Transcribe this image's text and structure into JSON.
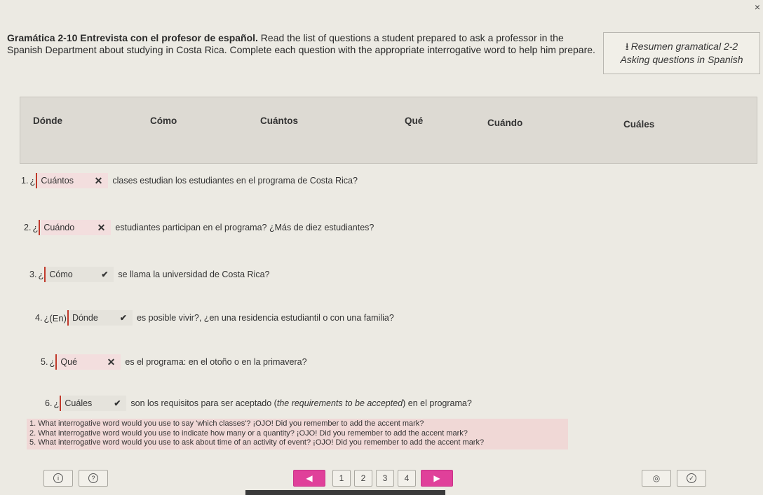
{
  "window": {
    "close_glyph": "×"
  },
  "instructions": {
    "title": "Gramática 2-10 Entrevista con el profesor de español.",
    "body": " Read the list of questions a student prepared to ask a professor in the Spanish Department about studying in Costa Rica. Complete each question with the appropriate interrogative word to help him prepare."
  },
  "resource": {
    "icon": "download-icon",
    "line1": "Resumen gramatical 2-2",
    "line2": "Asking questions in Spanish"
  },
  "word_bank": [
    "Dónde",
    "Cómo",
    "Cuántos",
    "Qué",
    "Cuándo",
    "Cuáles"
  ],
  "questions": [
    {
      "num": "1.",
      "pre": "¿",
      "answer": "Cuántos",
      "status": "incorrect",
      "mark": "✕",
      "text": "clases estudian los estudiantes en el programa de Costa Rica?"
    },
    {
      "num": "2.",
      "pre": "¿",
      "answer": "Cuándo",
      "status": "incorrect",
      "mark": "✕",
      "text": "estudiantes participan en el programa? ¿Más de diez estudiantes?"
    },
    {
      "num": "3.",
      "pre": "¿",
      "answer": "Cómo",
      "status": "correct",
      "mark": "✔",
      "text": "se llama la universidad de Costa Rica?"
    },
    {
      "num": "4.",
      "pre": "¿(En)",
      "answer": "Dónde",
      "status": "correct",
      "mark": "✔",
      "text": "es posible vivir?, ¿en una residencia estudiantil o con una familia?"
    },
    {
      "num": "5.",
      "pre": "¿",
      "answer": "Qué",
      "status": "incorrect",
      "mark": "✕",
      "text": "es el programa: en el otoño o en la primavera?"
    },
    {
      "num": "6.",
      "pre": "¿",
      "answer": "Cuáles",
      "status": "correct",
      "mark": "✔",
      "text_before": "son los requisitos para ser aceptado (",
      "text_italic": "the requirements to be accepted",
      "text_after": ") en el programa?"
    }
  ],
  "feedback": [
    "1. What interrogative word would you use to say 'which classes'? ¡OJO! Did you remember to add the accent mark?",
    "2. What interrogative word would you use to indicate how many or a quantity? ¡OJO! Did you remember to add the accent mark?",
    "5. What interrogative word would you use to ask about time of an activity of event? ¡OJO! Did you remember to add the accent mark?"
  ],
  "pagination": {
    "pages": [
      "1",
      "2",
      "3",
      "4"
    ],
    "prev": "◀",
    "next": "▶"
  },
  "bottom_left": {
    "info_glyph": "i",
    "help_glyph": "?"
  },
  "bottom_right": {
    "eye_glyph": "◎",
    "check_glyph": "✓"
  }
}
